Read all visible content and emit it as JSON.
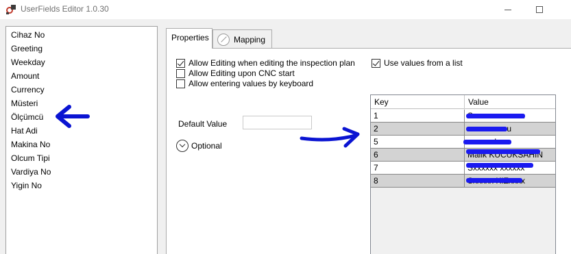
{
  "window": {
    "title": "UserFields Editor 1.0.30",
    "app_icon": "app-gear-icon",
    "controls": [
      "minimize-icon",
      "maximize-icon"
    ]
  },
  "field_list": {
    "items": [
      "Cihaz No",
      "Greeting",
      "Weekday",
      "Amount",
      "Currency",
      "Müsteri",
      "Ölçümcü",
      "Hat Adi",
      "Makina No",
      "Olcum Tipi",
      "Vardiya No",
      "Yigin No"
    ],
    "selected": "Ölçümcü"
  },
  "tabs": {
    "properties": "Properties",
    "mapping": "Mapping",
    "active": "Properties"
  },
  "properties": {
    "allow_editing_inspection_plan": {
      "label": "Allow Editing when editing the inspection plan",
      "checked": true
    },
    "allow_editing_cnc_start": {
      "label": "Allow Editing upon CNC start",
      "checked": false
    },
    "allow_entering_keyboard": {
      "label": "Allow entering values by keyboard",
      "checked": false
    },
    "default_value_label": "Default Value",
    "default_value": "",
    "optional_label": "Optional",
    "use_values_from_list": {
      "label": "Use values from a list",
      "checked": true
    }
  },
  "values_grid": {
    "columns": [
      "Key",
      "Value"
    ],
    "rows": [
      {
        "key": "1",
        "value": "Sxxxxx xxxxxxx"
      },
      {
        "key": "2",
        "value": "xxxxx xxzcu"
      },
      {
        "key": "5",
        "value": "xxxx xxkxx"
      },
      {
        "key": "6",
        "value": "Malik KUCUKSAHIN"
      },
      {
        "key": "7",
        "value": "Sxxxxxx xxxxxx"
      },
      {
        "key": "8",
        "value": "Sxxxxx KIZxxxx"
      }
    ]
  },
  "annotations": {
    "color": "#0a14d2"
  }
}
